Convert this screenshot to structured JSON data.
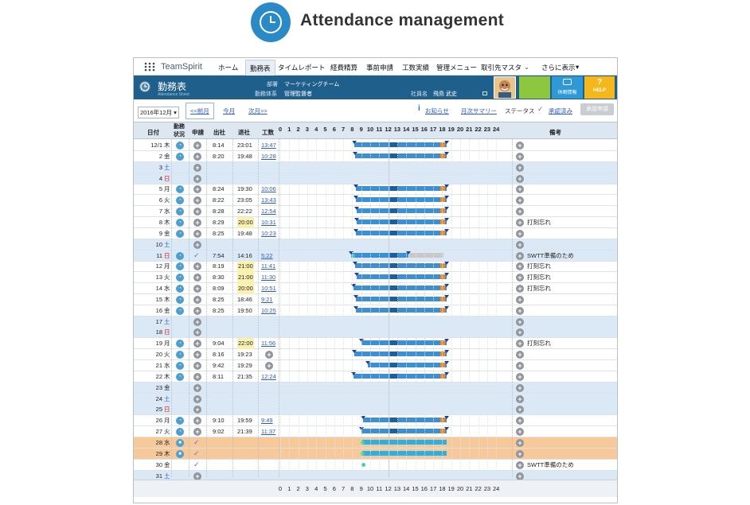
{
  "hero": {
    "title": "Attendance management",
    "icon": "clock-icon",
    "circle_color": "#2a8ac8"
  },
  "nav": {
    "brand": "TeamSpirit",
    "tabs": [
      "ホーム",
      "勤務表",
      "タイムレポート",
      "経費精算",
      "事前申請",
      "工数実績",
      "管理メニュー",
      "取引先マスタ",
      "さらに表示"
    ],
    "active": "勤務表"
  },
  "header": {
    "title": "勤務表",
    "subtitle": "Attendance Sheet",
    "dept_label": "部署",
    "dept_value": "マーケティングチーム",
    "system_label": "勤務体系",
    "system_value": "管理監督者",
    "emp_label": "社員名",
    "emp_value": "飛鳥 武史",
    "btn_vacation": "休暇情報",
    "btn_help": "HELP",
    "accent": "#1f5f8b"
  },
  "toolbar": {
    "month": "2016年12月",
    "prev": "<<前月",
    "today": "今月",
    "next": "次月>>",
    "notice": "お知らせ",
    "monthly": "月次サマリー",
    "status_label": "ステータス",
    "status_value": "承認済み",
    "approve_btn": "承認申請"
  },
  "columns": {
    "date": "日付",
    "work_status": "勤務状況",
    "apply": "申請",
    "in": "出社",
    "out": "退社",
    "hours": "工数",
    "remarks": "備考",
    "timeline": [
      "0",
      "1",
      "2",
      "3",
      "4",
      "5",
      "6",
      "7",
      "8",
      "9",
      "10",
      "11",
      "12",
      "13",
      "14",
      "15",
      "16",
      "17",
      "18",
      "19",
      "20",
      "21",
      "22",
      "23",
      "24"
    ]
  },
  "rows": [
    {
      "d": "12/1",
      "w": "木",
      "in": "8:14",
      "out": "23:01",
      "h": "13:47",
      "r": ""
    },
    {
      "d": "2",
      "w": "金",
      "in": "8:20",
      "out": "19:48",
      "h": "10:28",
      "r": ""
    },
    {
      "d": "3",
      "w": "土",
      "in": "",
      "out": "",
      "h": "",
      "r": ""
    },
    {
      "d": "4",
      "w": "日",
      "in": "",
      "out": "",
      "h": "",
      "r": ""
    },
    {
      "d": "5",
      "w": "月",
      "in": "8:24",
      "out": "19:30",
      "h": "10:06",
      "r": ""
    },
    {
      "d": "6",
      "w": "火",
      "in": "8:22",
      "out": "23:05",
      "h": "13:43",
      "r": ""
    },
    {
      "d": "7",
      "w": "水",
      "in": "8:28",
      "out": "22:22",
      "h": "12:54",
      "r": ""
    },
    {
      "d": "8",
      "w": "木",
      "in": "8:29",
      "out": "20:00",
      "h": "10:31",
      "r": "打刻忘れ"
    },
    {
      "d": "9",
      "w": "金",
      "in": "8:25",
      "out": "19:48",
      "h": "10:23",
      "r": ""
    },
    {
      "d": "10",
      "w": "土",
      "in": "",
      "out": "",
      "h": "",
      "r": ""
    },
    {
      "d": "11",
      "w": "日",
      "in": "7:54",
      "out": "14:16",
      "h": "5:22",
      "r": "SWTT準備のため"
    },
    {
      "d": "12",
      "w": "月",
      "in": "8:19",
      "out": "21:00",
      "h": "11:41",
      "r": "打刻忘れ"
    },
    {
      "d": "13",
      "w": "火",
      "in": "8:30",
      "out": "21:00",
      "h": "11:30",
      "r": "打刻忘れ"
    },
    {
      "d": "14",
      "w": "水",
      "in": "8:09",
      "out": "20:00",
      "h": "10:51",
      "r": "打刻忘れ"
    },
    {
      "d": "15",
      "w": "木",
      "in": "8:25",
      "out": "18:46",
      "h": "9:21",
      "r": ""
    },
    {
      "d": "16",
      "w": "金",
      "in": "8:25",
      "out": "19:50",
      "h": "10:25",
      "r": ""
    },
    {
      "d": "17",
      "w": "土",
      "in": "",
      "out": "",
      "h": "",
      "r": ""
    },
    {
      "d": "18",
      "w": "日",
      "in": "",
      "out": "",
      "h": "",
      "r": ""
    },
    {
      "d": "19",
      "w": "月",
      "in": "9:04",
      "out": "22:00",
      "h": "11:56",
      "r": "打刻忘れ"
    },
    {
      "d": "20",
      "w": "火",
      "in": "8:16",
      "out": "19:23",
      "h": "",
      "r": ""
    },
    {
      "d": "21",
      "w": "水",
      "in": "9:42",
      "out": "19:29",
      "h": "",
      "r": ""
    },
    {
      "d": "22",
      "w": "木",
      "in": "8:11",
      "out": "21:35",
      "h": "12:24",
      "r": ""
    },
    {
      "d": "23",
      "w": "金",
      "in": "",
      "out": "",
      "h": "",
      "r": ""
    },
    {
      "d": "24",
      "w": "土",
      "in": "",
      "out": "",
      "h": "",
      "r": ""
    },
    {
      "d": "25",
      "w": "日",
      "in": "",
      "out": "",
      "h": "",
      "r": ""
    },
    {
      "d": "26",
      "w": "月",
      "in": "9:10",
      "out": "19:59",
      "h": "9:49",
      "r": ""
    },
    {
      "d": "27",
      "w": "火",
      "in": "9:02",
      "out": "21:39",
      "h": "11:37",
      "r": ""
    },
    {
      "d": "28",
      "w": "水",
      "in": "",
      "out": "",
      "h": "",
      "r": ""
    },
    {
      "d": "29",
      "w": "木",
      "in": "",
      "out": "",
      "h": "",
      "r": ""
    },
    {
      "d": "30",
      "w": "金",
      "in": "",
      "out": "",
      "h": "",
      "r": "SWTT準備のため"
    },
    {
      "d": "31",
      "w": "土",
      "in": "",
      "out": "",
      "h": "",
      "r": ""
    }
  ]
}
